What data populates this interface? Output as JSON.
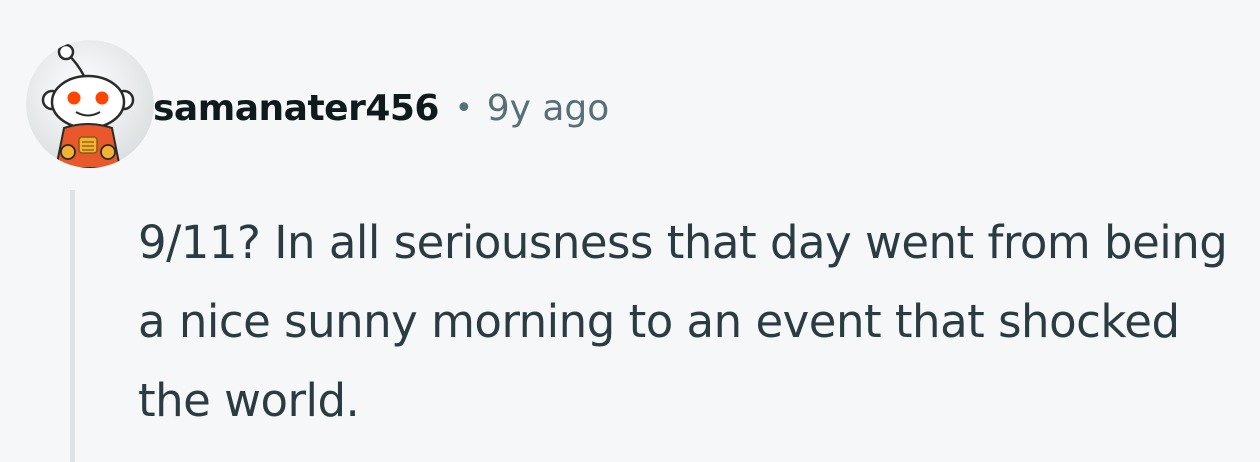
{
  "comment": {
    "author": "samanater456",
    "separator": "•",
    "timestamp": "9y ago",
    "body": "9/11? In all seriousness that day went from being a nice sunny morning to an event that shocked the world.",
    "avatar_icon": "snoo-avatar-icon"
  },
  "colors": {
    "background": "#f6f7f8",
    "author": "#0f1a1c",
    "meta": "#576f76",
    "body": "#2a3c42",
    "thread_line": "#dde3e6",
    "avatar_accent": "#ff4500"
  }
}
